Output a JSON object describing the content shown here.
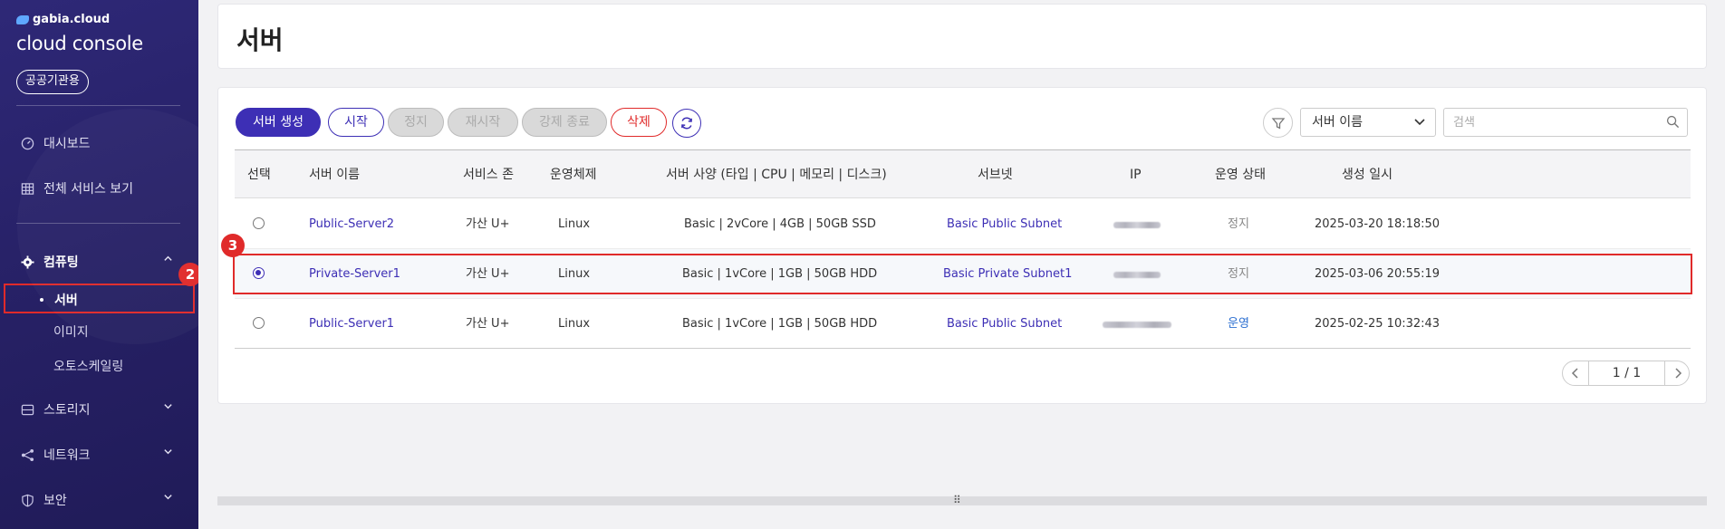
{
  "app": {
    "brand_small": "gabia.cloud",
    "brand_main": "cloud console",
    "badge": "공공기관용"
  },
  "sidebar": {
    "dashboard": "대시보드",
    "all_services": "전체 서비스 보기",
    "computing": "컴퓨팅",
    "computing_items": [
      "서버",
      "이미지",
      "오토스케일링"
    ],
    "storage": "스토리지",
    "network": "네트워크",
    "security": "보안"
  },
  "annotations": {
    "step2": "2",
    "step3": "3"
  },
  "page": {
    "title": "서버"
  },
  "toolbar": {
    "create": "서버 생성",
    "start": "시작",
    "stop": "정지",
    "restart": "재시작",
    "force_stop": "강제 종료",
    "delete": "삭제",
    "filter_select": "서버 이름",
    "search_placeholder": "검색"
  },
  "table": {
    "headers": [
      "선택",
      "서버 이름",
      "서비스 존",
      "운영체제",
      "서버 사양 (타입 | CPU | 메모리 | 디스크)",
      "서브넷",
      "IP",
      "운영 상태",
      "생성 일시"
    ],
    "rows": [
      {
        "name": "Public-Server2",
        "zone": "가산 U+",
        "os": "Linux",
        "spec": "Basic | 2vCore | 4GB | 50GB SSD",
        "subnet": "Basic Public Subnet",
        "status": "정지",
        "created": "2025-03-20 18:18:50",
        "selected": false
      },
      {
        "name": "Private-Server1",
        "zone": "가산 U+",
        "os": "Linux",
        "spec": "Basic | 1vCore | 1GB | 50GB HDD",
        "subnet": "Basic Private Subnet1",
        "status": "정지",
        "created": "2025-03-06 20:55:19",
        "selected": true
      },
      {
        "name": "Public-Server1",
        "zone": "가산 U+",
        "os": "Linux",
        "spec": "Basic | 1vCore | 1GB | 50GB HDD",
        "subnet": "Basic Public Subnet",
        "status": "운영",
        "created": "2025-02-25 10:32:43",
        "selected": false
      }
    ]
  },
  "pagination": {
    "label": "1 / 1"
  },
  "colors": {
    "accent": "#3d2fb5",
    "danger": "#e02a2a",
    "sidebar": "#262064",
    "running": "#2c6fd1"
  }
}
